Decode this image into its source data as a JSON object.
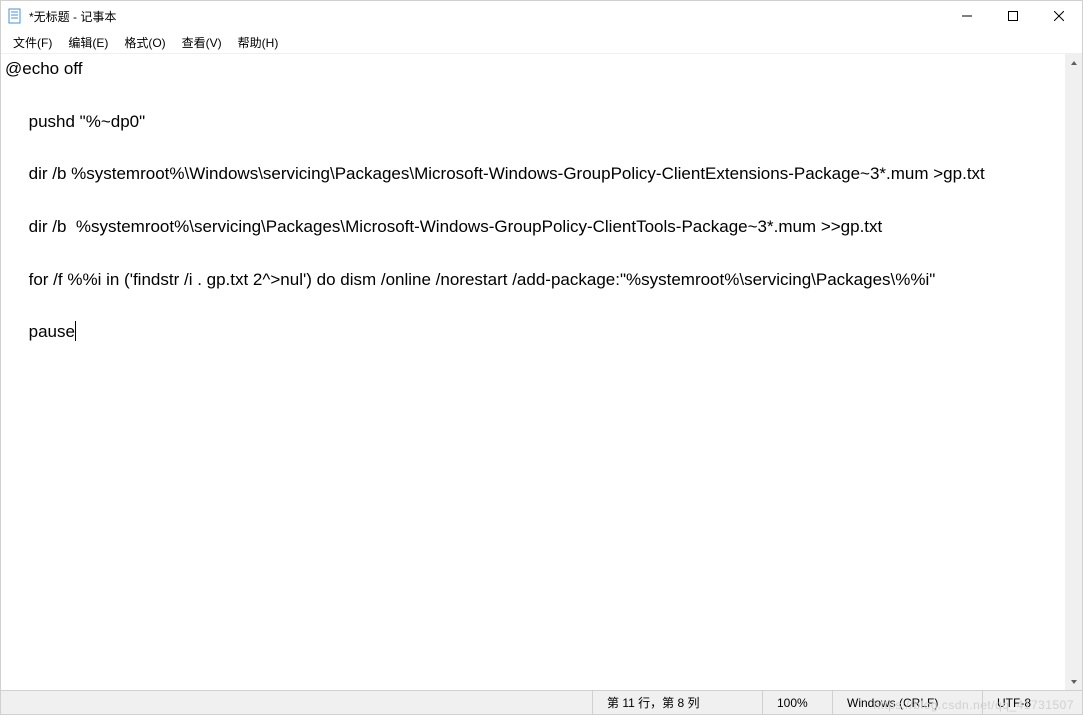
{
  "window": {
    "title": "*无标题 - 记事本"
  },
  "menu": {
    "file": "文件(F)",
    "edit": "编辑(E)",
    "format": "格式(O)",
    "view": "查看(V)",
    "help": "帮助(H)"
  },
  "editor": {
    "content": "@echo off\n\n     pushd \"%~dp0\"\n\n     dir /b %systemroot%\\Windows\\servicing\\Packages\\Microsoft-Windows-GroupPolicy-ClientExtensions-Package~3*.mum >gp.txt\n\n     dir /b  %systemroot%\\servicing\\Packages\\Microsoft-Windows-GroupPolicy-ClientTools-Package~3*.mum >>gp.txt\n\n     for /f %%i in ('findstr /i . gp.txt 2^>nul') do dism /online /norestart /add-package:\"%systemroot%\\servicing\\Packages\\%%i\"\n\n     pause"
  },
  "status": {
    "position": "第 11 行，第 8 列",
    "zoom": "100%",
    "line_ending": "Windows (CRLF)",
    "encoding": "UTF-8"
  },
  "watermark": "https://blog.csdn.net/qq_41731507"
}
